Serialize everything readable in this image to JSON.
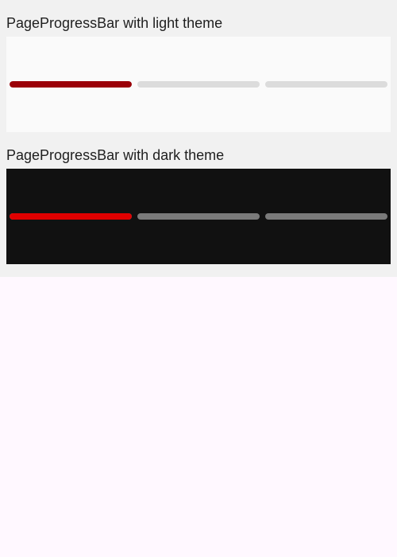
{
  "light_demo": {
    "title": "PageProgressBar with light theme",
    "colors": {
      "track": "#dcdcdc",
      "active": "#9b0008"
    },
    "pages": [
      {
        "progress": 1.0
      },
      {
        "progress": 0.0
      },
      {
        "progress": 0.0
      }
    ]
  },
  "dark_demo": {
    "title": "PageProgressBar with dark theme",
    "colors": {
      "track": "#7a7a7a",
      "active": "#e00000"
    },
    "pages": [
      {
        "progress": 1.0
      },
      {
        "progress": 0.0
      },
      {
        "progress": 0.0
      }
    ]
  }
}
